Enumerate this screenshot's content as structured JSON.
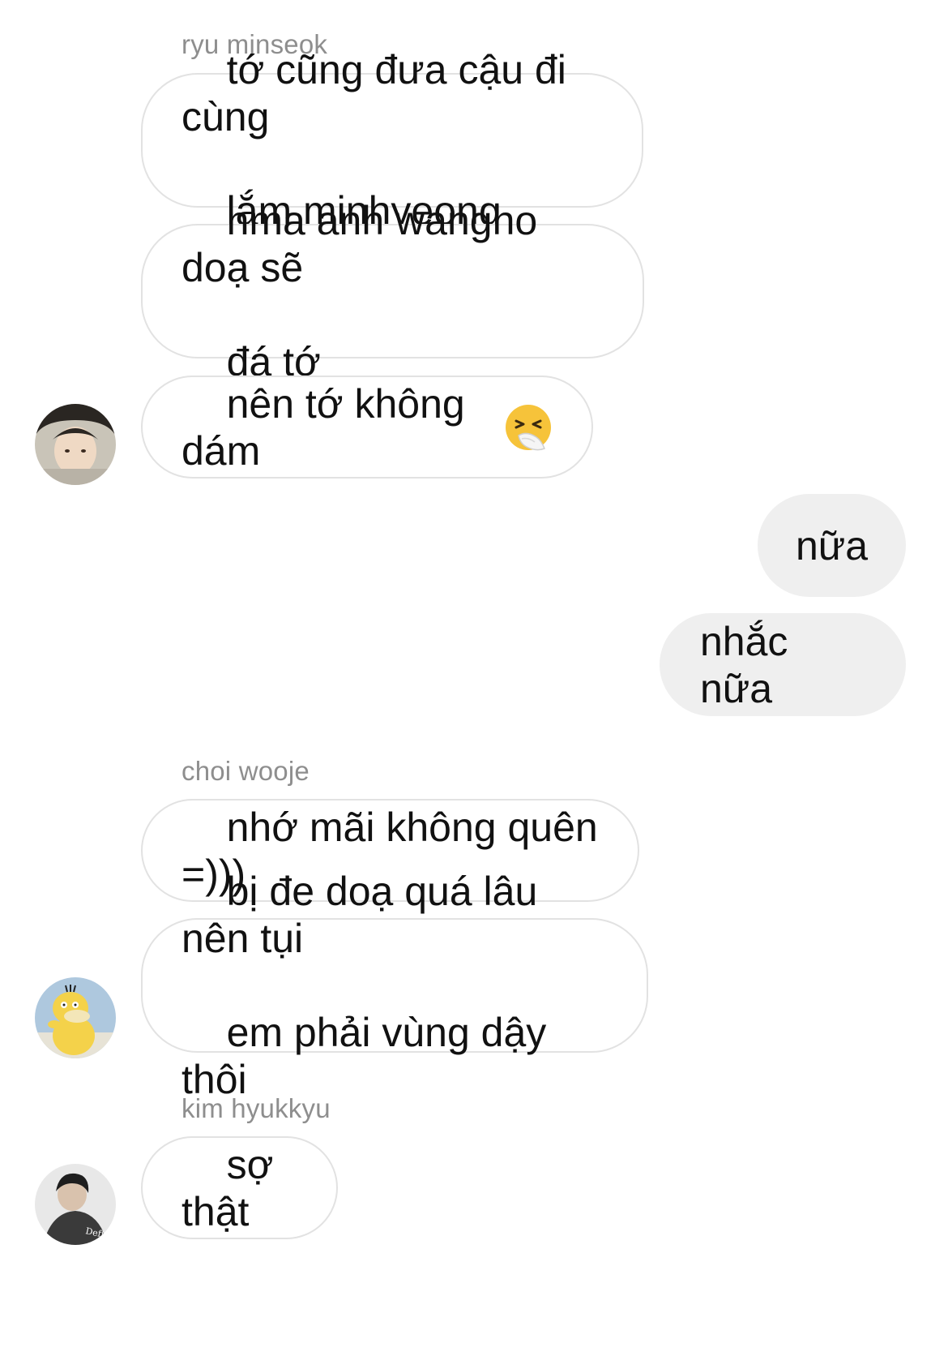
{
  "thread": {
    "messages": [
      {
        "sender": "ryu minseok",
        "lines": [
          "tớ cũng đưa cậu đi cùng",
          "lắm minhyeong"
        ]
      },
      {
        "lines": [
          "nma anh wangho doạ sẽ",
          "đá tớ"
        ]
      },
      {
        "lines": [
          "nên tớ không dám"
        ],
        "emoji": "sneezing-face-emoji"
      },
      {
        "outgoing": true,
        "text": "nữa"
      },
      {
        "outgoing": true,
        "text": "nhắc nữa"
      },
      {
        "sender": "choi wooje",
        "lines": [
          "nhớ mãi không quên =)))"
        ]
      },
      {
        "lines": [
          "bị đe doạ quá lâu nên tụi",
          "em phải vùng dậy thôi"
        ]
      },
      {
        "sender": "kim hyukkyu",
        "lines": [
          "sợ thật"
        ]
      }
    ],
    "avatars": {
      "ryu_minseok": "avatar-photo-icon",
      "choi_wooje": "psyduck-avatar-icon",
      "kim_hyukkyu": "deft-avatar-icon"
    },
    "avatar_caption_kim": "Deft"
  },
  "colors": {
    "incoming_border": "#e2e2e2",
    "outgoing_bg": "#efefef",
    "sender_name": "#8e8e8e",
    "text": "#111111"
  }
}
